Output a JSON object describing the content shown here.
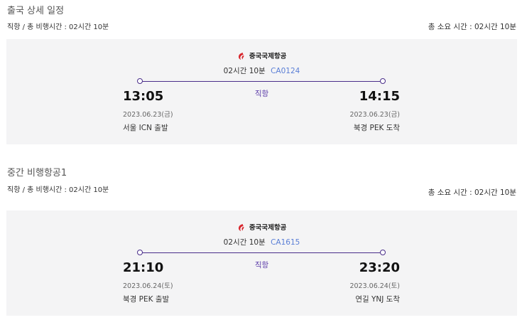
{
  "segments": [
    {
      "section_title": "출국 상세 일정",
      "sub_left": "직항 / 총 비행시간 : 02시간 10분",
      "total_duration": "총 소요 시간 : 02시간 10분",
      "airline": "중국국제항공",
      "duration": "02시간 10분",
      "flight_no": "CA0124",
      "stop_type": "직항",
      "dep_time": "13:05",
      "dep_date": "2023.06.23(금)",
      "dep_place": "서울 ICN 출발",
      "arr_time": "14:15",
      "arr_date": "2023.06.23(금)",
      "arr_place": "북경 PEK 도착"
    },
    {
      "section_title": "중간 비행항공1",
      "sub_left": "직항 / 총 비행시간 : 02시간 10분",
      "total_duration": "총 소요 시간 : 02시간 10분",
      "airline": "중국국제항공",
      "duration": "02시간 10분",
      "flight_no": "CA1615",
      "stop_type": "직항",
      "dep_time": "21:10",
      "dep_date": "2023.06.24(토)",
      "dep_place": "북경 PEK 출발",
      "arr_time": "23:20",
      "arr_date": "2023.06.24(토)",
      "arr_place": "연길 YNJ 도착"
    }
  ],
  "colors": {
    "card_bg": "#f4f4f5",
    "route_line": "#4a2e8a",
    "direct_text": "#5a3aa8",
    "flight_no": "#5b7fd6",
    "airline_logo": "#d8262d"
  },
  "icons": {
    "airline_logo": "air-china-phoenix-logo"
  }
}
